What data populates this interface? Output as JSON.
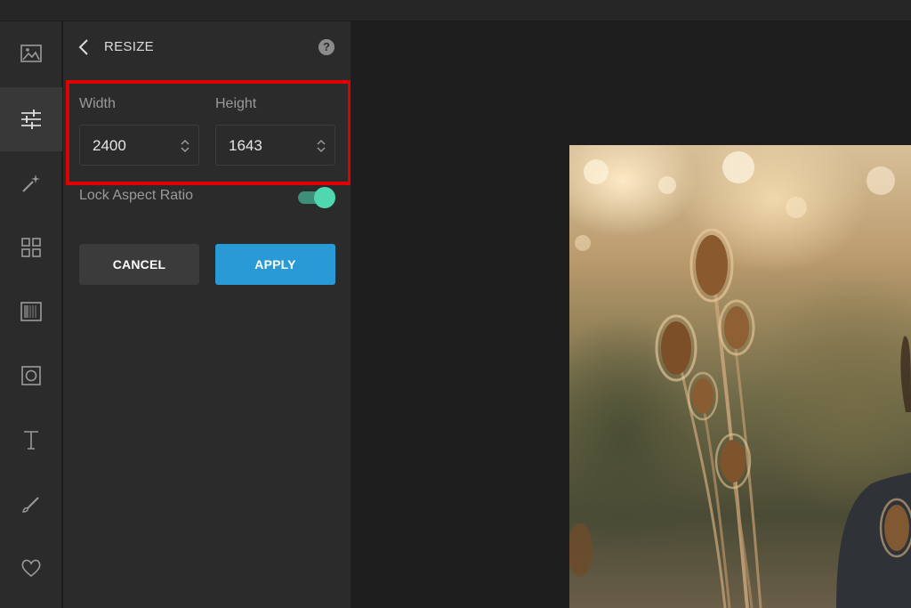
{
  "panel": {
    "title": "RESIZE",
    "help": "?"
  },
  "resize": {
    "width_label": "Width",
    "height_label": "Height",
    "width_value": "2400",
    "height_value": "1643",
    "lock_label": "Lock Aspect Ratio",
    "lock_enabled": true
  },
  "actions": {
    "cancel_label": "CANCEL",
    "apply_label": "APPLY"
  },
  "rail": {
    "items": [
      {
        "icon": "image-icon",
        "active": false
      },
      {
        "icon": "sliders-icon",
        "active": true
      },
      {
        "icon": "magic-wand-icon",
        "active": false
      },
      {
        "icon": "grid-icon",
        "active": false
      },
      {
        "icon": "texture-icon",
        "active": false
      },
      {
        "icon": "frame-icon",
        "active": false
      },
      {
        "icon": "text-icon",
        "active": false
      },
      {
        "icon": "brush-icon",
        "active": false
      },
      {
        "icon": "heart-icon",
        "active": false
      }
    ]
  },
  "colors": {
    "accent": "#2a9ad6",
    "toggle_on": "#4fd7b0",
    "highlight": "#e00000"
  }
}
